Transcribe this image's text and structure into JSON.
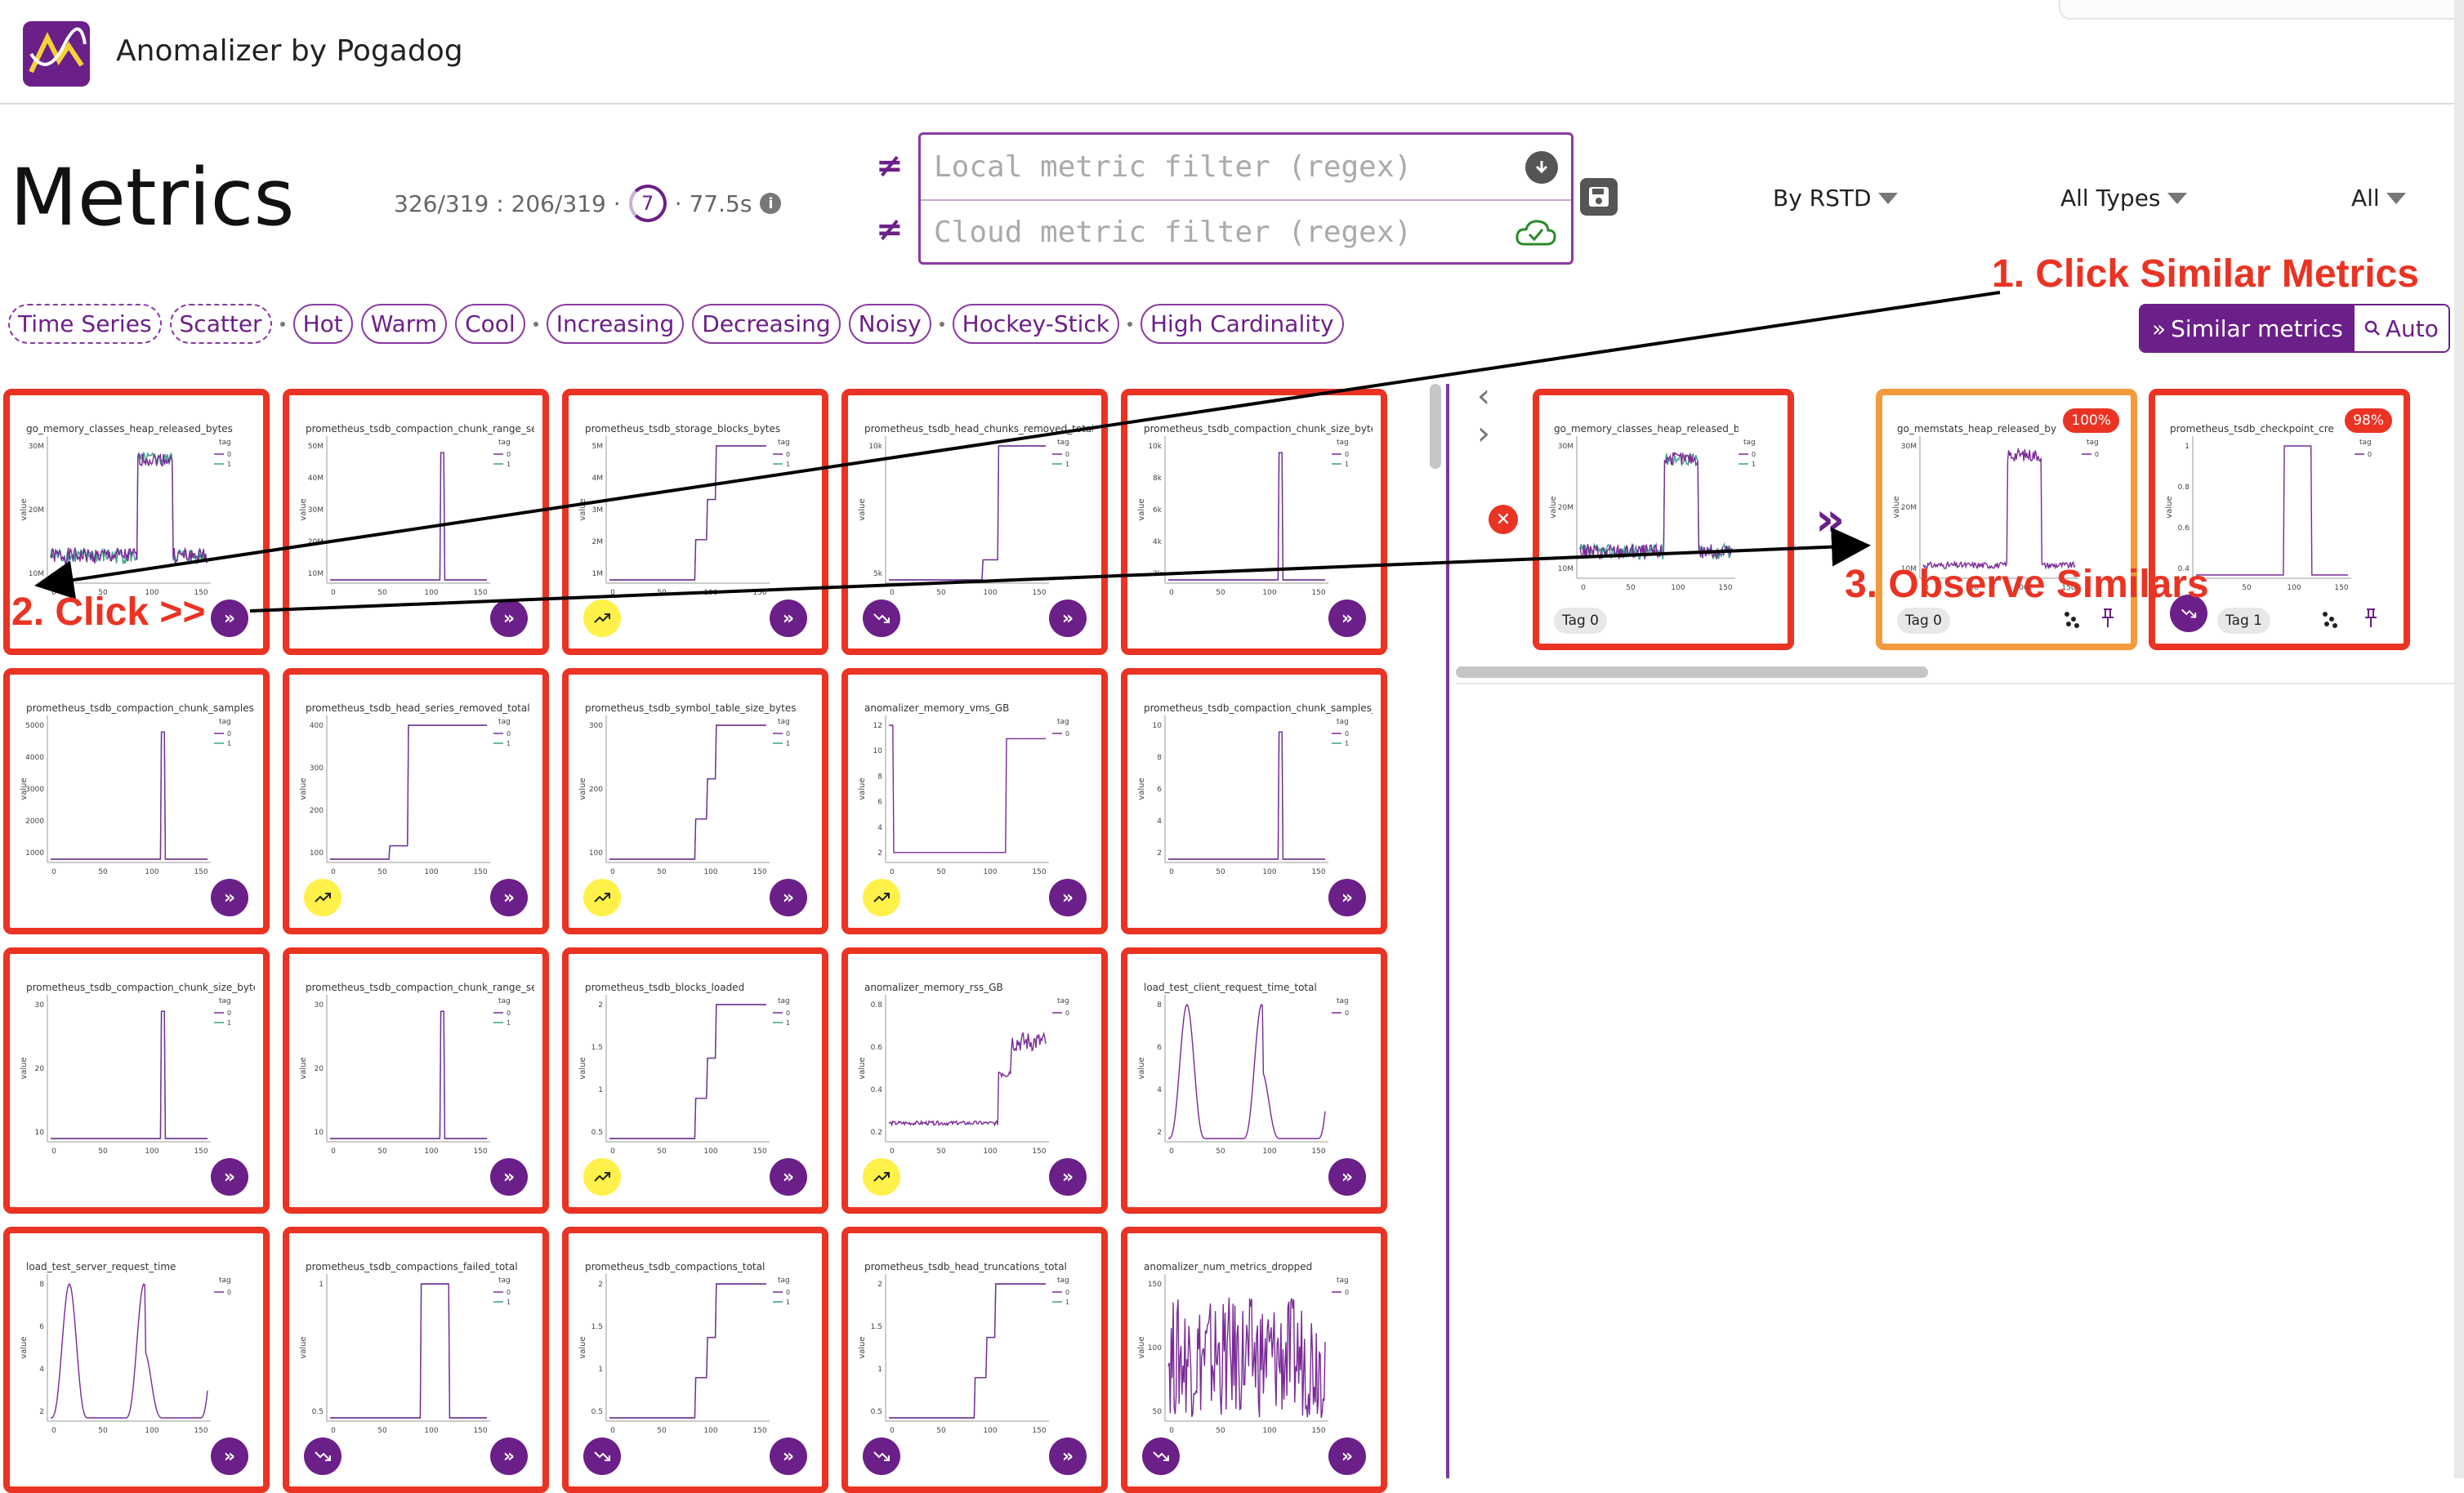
{
  "app": {
    "title": "Anomalizer by Pogadog"
  },
  "page": {
    "title": "Metrics"
  },
  "stats": {
    "counts": "326/319 : 206/319 ·",
    "ring": "7",
    "time": "· 77.5s",
    "info": "i"
  },
  "filters": {
    "local_placeholder": "Local metric filter (regex)",
    "cloud_placeholder": "Cloud metric filter (regex)",
    "neq": "≠"
  },
  "dropdowns": {
    "sort": "By RSTD",
    "types": "All Types",
    "all": "All"
  },
  "chips": [
    "Time Series",
    "Scatter",
    "Hot",
    "Warm",
    "Cool",
    "Increasing",
    "Decreasing",
    "Noisy",
    "Hockey-Stick",
    "High Cardinality"
  ],
  "similar": {
    "button": "Similar metrics",
    "auto": "Auto"
  },
  "icons": {
    "forward": "»",
    "close": "✕",
    "chev_left": "‹",
    "chev_right": "›",
    "big_forward": "»"
  },
  "cards": [
    {
      "title": "go_memory_classes_heap_released_bytes",
      "badge": "none",
      "shape": "heap",
      "yticks": [
        "30M",
        "20M",
        "10M"
      ],
      "legend": [
        "0",
        "1"
      ]
    },
    {
      "title": "prometheus_tsdb_compaction_chunk_range_seco",
      "badge": "none",
      "shape": "spike",
      "yticks": [
        "50M",
        "40M",
        "30M",
        "20M",
        "10M"
      ],
      "legend": [
        "0",
        "1"
      ]
    },
    {
      "title": "prometheus_tsdb_storage_blocks_bytes",
      "badge": "up",
      "shape": "steps_up",
      "yticks": [
        "5M",
        "4M",
        "3M",
        "2M",
        "1M"
      ],
      "legend": [
        "0",
        "1"
      ]
    },
    {
      "title": "prometheus_tsdb_head_chunks_removed_total",
      "badge": "down",
      "shape": "step_late",
      "yticks": [
        "10k",
        "5k"
      ],
      "legend": [
        "0",
        "1"
      ]
    },
    {
      "title": "prometheus_tsdb_compaction_chunk_size_bytes",
      "badge": "none",
      "shape": "spike",
      "yticks": [
        "10k",
        "8k",
        "6k",
        "4k",
        "2k"
      ],
      "legend": [
        "0",
        "1"
      ]
    },
    {
      "title": "prometheus_tsdb_compaction_chunk_samples",
      "badge": "none",
      "shape": "spike",
      "yticks": [
        "5000",
        "4000",
        "3000",
        "2000",
        "1000"
      ],
      "legend": [
        "0",
        "1"
      ]
    },
    {
      "title": "prometheus_tsdb_head_series_removed_total",
      "badge": "up",
      "shape": "step_up_high",
      "yticks": [
        "400",
        "300",
        "200",
        "100"
      ],
      "legend": [
        "0",
        "1"
      ]
    },
    {
      "title": "prometheus_tsdb_symbol_table_size_bytes",
      "badge": "up",
      "shape": "steps_up",
      "yticks": [
        "300",
        "200",
        "100"
      ],
      "legend": [
        "0",
        "1"
      ]
    },
    {
      "title": "anomalizer_memory_vms_GB",
      "badge": "up",
      "shape": "vms",
      "yticks": [
        "12",
        "10",
        "8",
        "6",
        "4",
        "2"
      ],
      "legend": [
        "0"
      ]
    },
    {
      "title": "prometheus_tsdb_compaction_chunk_samples_co",
      "badge": "none",
      "shape": "spike",
      "yticks": [
        "10",
        "8",
        "6",
        "4",
        "2"
      ],
      "legend": [
        "0",
        "1"
      ]
    },
    {
      "title": "prometheus_tsdb_compaction_chunk_size_bytes_",
      "badge": "none",
      "shape": "spike",
      "yticks": [
        "30",
        "20",
        "10"
      ],
      "legend": [
        "0",
        "1"
      ]
    },
    {
      "title": "prometheus_tsdb_compaction_chunk_range_seco",
      "badge": "none",
      "shape": "spike",
      "yticks": [
        "30",
        "20",
        "10"
      ],
      "legend": [
        "0",
        "1"
      ]
    },
    {
      "title": "prometheus_tsdb_blocks_loaded",
      "badge": "up",
      "shape": "steps_up",
      "yticks": [
        "2",
        "1.5",
        "1",
        "0.5"
      ],
      "legend": [
        "0",
        "1"
      ]
    },
    {
      "title": "anomalizer_memory_rss_GB",
      "badge": "up",
      "shape": "rss",
      "yticks": [
        "0.8",
        "0.6",
        "0.4",
        "0.2"
      ],
      "legend": [
        "0"
      ]
    },
    {
      "title": "load_test_client_request_time_total",
      "badge": "none",
      "shape": "waves",
      "yticks": [
        "8",
        "6",
        "4",
        "2"
      ],
      "legend": [
        "0"
      ]
    },
    {
      "title": "load_test_server_request_time",
      "badge": "none",
      "shape": "waves",
      "yticks": [
        "8",
        "6",
        "4",
        "2"
      ],
      "legend": [
        "0"
      ]
    },
    {
      "title": "prometheus_tsdb_compactions_failed_total",
      "badge": "down",
      "shape": "pulse",
      "yticks": [
        "1",
        "0.5"
      ],
      "legend": [
        "0",
        "1"
      ]
    },
    {
      "title": "prometheus_tsdb_compactions_total",
      "badge": "down",
      "shape": "steps_up",
      "yticks": [
        "2",
        "1.5",
        "1",
        "0.5"
      ],
      "legend": [
        "0",
        "1"
      ]
    },
    {
      "title": "prometheus_tsdb_head_truncations_total",
      "badge": "down",
      "shape": "steps_up",
      "yticks": [
        "2",
        "1.5",
        "1",
        "0.5"
      ],
      "legend": [
        "0",
        "1"
      ]
    },
    {
      "title": "anomalizer_num_metrics_dropped",
      "badge": "down",
      "shape": "noise",
      "yticks": [
        "150",
        "100",
        "50"
      ],
      "legend": [
        "0"
      ]
    }
  ],
  "x_ticks": [
    "0",
    "50",
    "100",
    "150"
  ],
  "axis_label": "value",
  "legend_title": "tag",
  "right_cards": [
    {
      "title": "go_memory_classes_heap_released_bytes",
      "badge": "",
      "tag": "Tag 0",
      "shape": "heap",
      "yticks": [
        "30M",
        "20M",
        "10M"
      ],
      "legend": [
        "0",
        "1"
      ]
    },
    {
      "title": "go_memstats_heap_released_by",
      "badge": "100%",
      "tag": "Tag 0",
      "shape": "mem",
      "yticks": [
        "30M",
        "20M",
        "10M"
      ],
      "legend": [
        "0"
      ]
    },
    {
      "title": "prometheus_tsdb_checkpoint_cre",
      "badge": "98%",
      "tag": "Tag 1",
      "shape": "pulse",
      "yticks": [
        "1",
        "0.8",
        "0.6",
        "0.4"
      ],
      "legend": [
        "0"
      ]
    }
  ],
  "annotations": {
    "step1": "1. Click Similar Metrics",
    "step2": "2. Click >>",
    "step3": "3. Observe Similars"
  },
  "colors": {
    "brand": "#6b1f88",
    "card_border": "#ea3323",
    "similar_border": "#f49a3c",
    "series_teal": "#3aa08a",
    "series_purple": "#7a2a96",
    "highlight": "#fff14a"
  }
}
